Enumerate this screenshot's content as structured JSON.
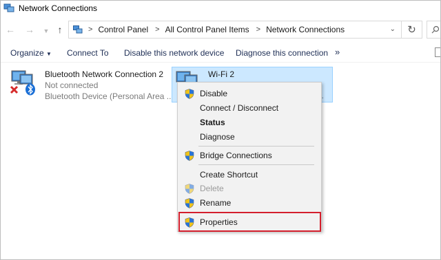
{
  "window": {
    "title": "Network Connections"
  },
  "address": {
    "breadcrumbs": [
      "Control Panel",
      "All Control Panel Items",
      "Network Connections"
    ]
  },
  "commands": {
    "organize": "Organize",
    "connect_to": "Connect To",
    "disable_device": "Disable this network device",
    "diagnose": "Diagnose this connection",
    "more": "»"
  },
  "connections": [
    {
      "name": "Bluetooth Network Connection 2",
      "status": "Not connected",
      "device": "Bluetooth Device (Personal Area ..."
    },
    {
      "name": "Wi-Fi 2",
      "status_visible_fragment": "...",
      "selected": true
    }
  ],
  "context_menu": {
    "items": [
      {
        "label": "Disable",
        "icon": "shield-icon"
      },
      {
        "label": "Connect / Disconnect"
      },
      {
        "label": "Status",
        "bold": true
      },
      {
        "label": "Diagnose"
      },
      {
        "label": "Bridge Connections",
        "icon": "shield-icon"
      },
      {
        "label": "Create Shortcut"
      },
      {
        "label": "Delete",
        "icon": "shield-icon",
        "disabled": true
      },
      {
        "label": "Rename",
        "icon": "shield-icon"
      },
      {
        "label": "Properties",
        "icon": "shield-icon",
        "highlighted": true
      }
    ]
  },
  "colors": {
    "selection_bg": "#cce8ff",
    "selection_border": "#99d1ff",
    "highlight_border": "#d41e2c",
    "command_text": "#1e2e55"
  }
}
